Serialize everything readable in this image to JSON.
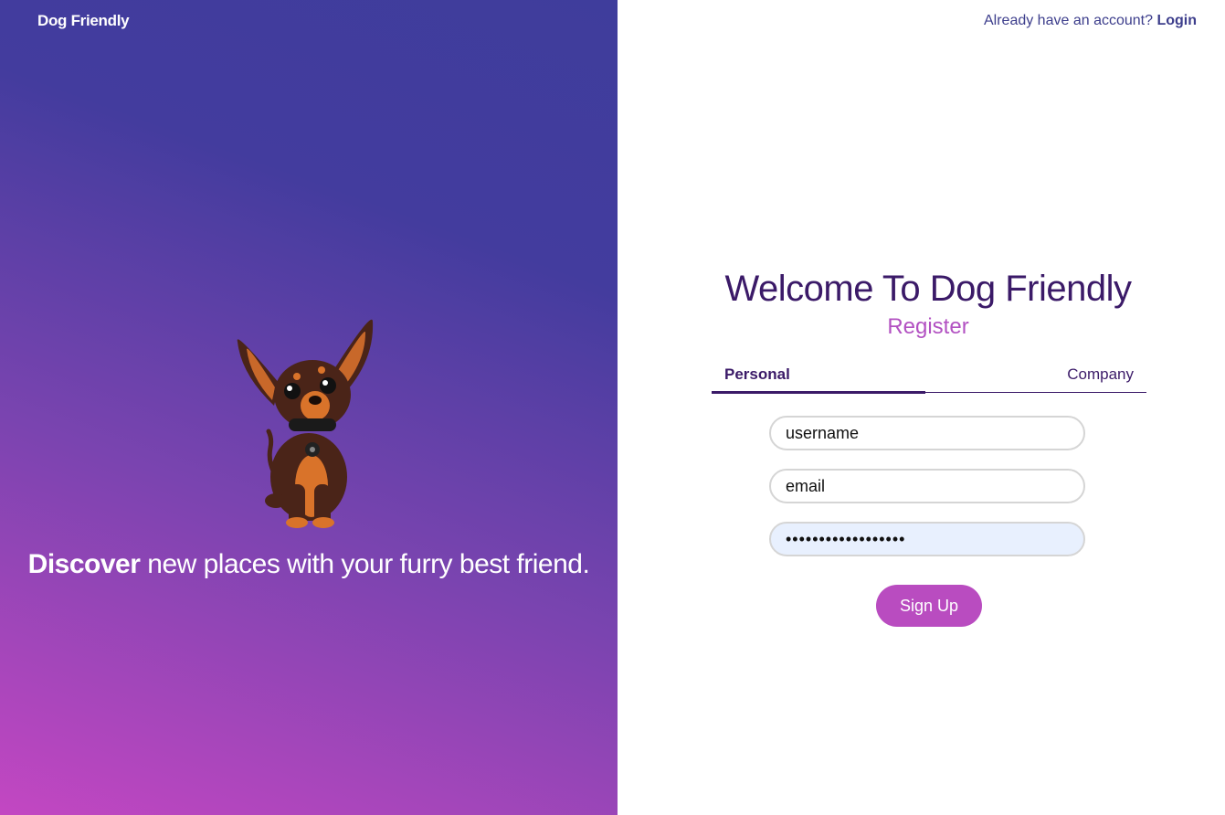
{
  "brand": "Dog Friendly",
  "hero": {
    "tagline_bold": "Discover",
    "tagline_rest": " new places with your furry best friend."
  },
  "header": {
    "prompt": "Already have an account? ",
    "login_label": "Login"
  },
  "form": {
    "title": "Welcome To Dog Friendly",
    "subtitle": "Register",
    "tabs": [
      {
        "label": "Personal",
        "active": true
      },
      {
        "label": "Company",
        "active": false
      }
    ],
    "username_placeholder": "username",
    "email_placeholder": "email",
    "password_value": "••••••••••••••••••",
    "submit_label": "Sign Up"
  },
  "colors": {
    "gradient_top": "#3f3d9c",
    "gradient_bottom": "#c347c2",
    "title": "#3b1a68",
    "subtitle": "#b251c2",
    "button": "#b94cc0",
    "autofill": "#e8f0fe"
  }
}
